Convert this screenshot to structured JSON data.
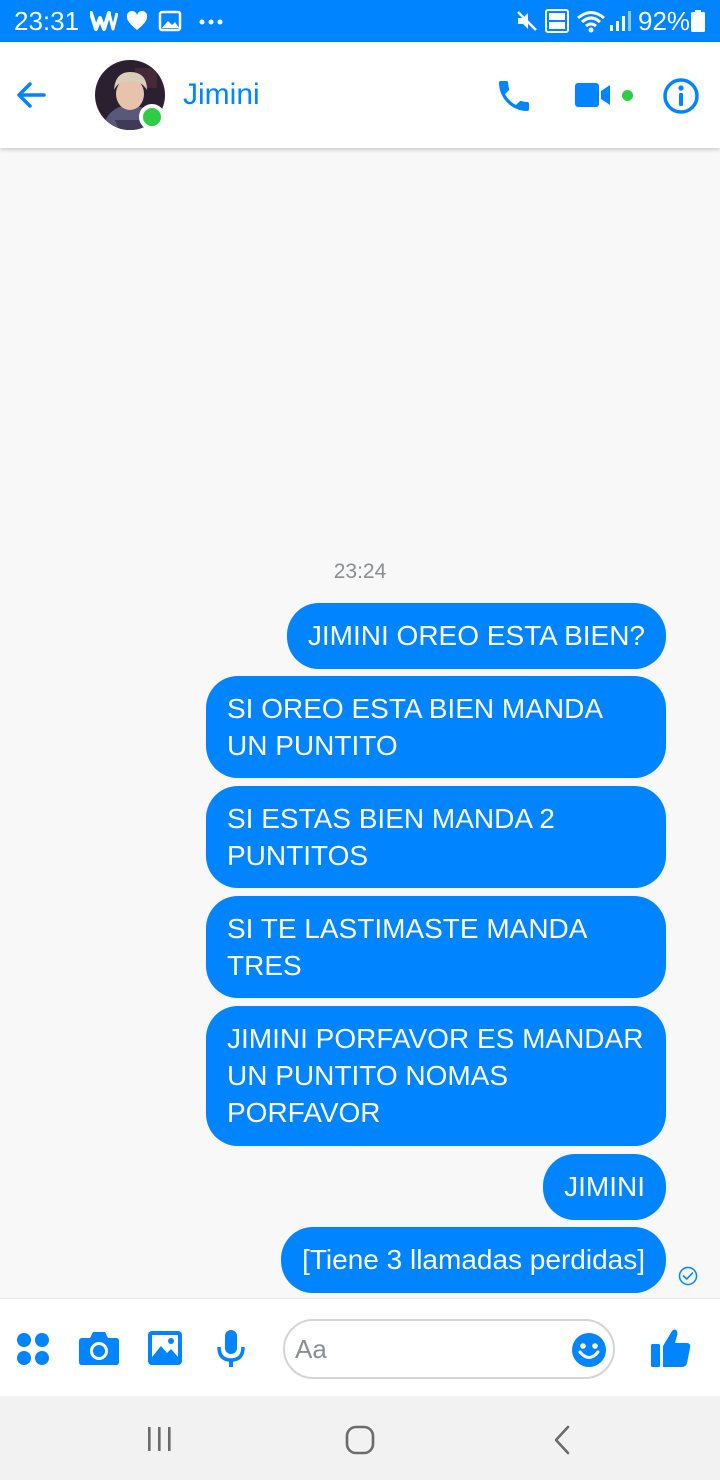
{
  "status_bar": {
    "time": "23:31",
    "battery": "92%",
    "left_icons": [
      "w-app-icon",
      "heart-icon",
      "image-icon",
      "more-dots-icon"
    ],
    "right_icons": [
      "mute-icon",
      "volte-icon",
      "wifi-icon",
      "signal-icon",
      "battery-icon"
    ]
  },
  "header": {
    "contact_name": "Jimini",
    "online": true,
    "icons": [
      "back-arrow-icon",
      "phone-icon",
      "video-icon",
      "info-icon"
    ]
  },
  "conversation": {
    "timestamp": "23:24",
    "messages": [
      "JIMINI OREO ESTA BIEN?",
      "SI OREO ESTA BIEN MANDA UN PUNTITO",
      "SI ESTAS BIEN MANDA 2 PUNTITOS",
      "SI TE LASTIMASTE MANDA TRES",
      "JIMINI PORFAVOR ES MANDAR UN PUNTITO NOMAS PORFAVOR",
      "JIMINI",
      "[Tiene 3 llamadas perdidas]"
    ],
    "last_status": "seen-check-icon"
  },
  "composer": {
    "placeholder": "Aa",
    "value": "",
    "icons": [
      "apps-grid-icon",
      "camera-icon",
      "gallery-icon",
      "microphone-icon",
      "emoji-icon",
      "thumbs-up-icon"
    ]
  },
  "navbar": {
    "icons": [
      "recent-apps-icon",
      "home-icon",
      "back-icon"
    ]
  },
  "colors": {
    "brand": "#0084ff",
    "online": "#31cc46",
    "background": "#f8f8f8"
  }
}
